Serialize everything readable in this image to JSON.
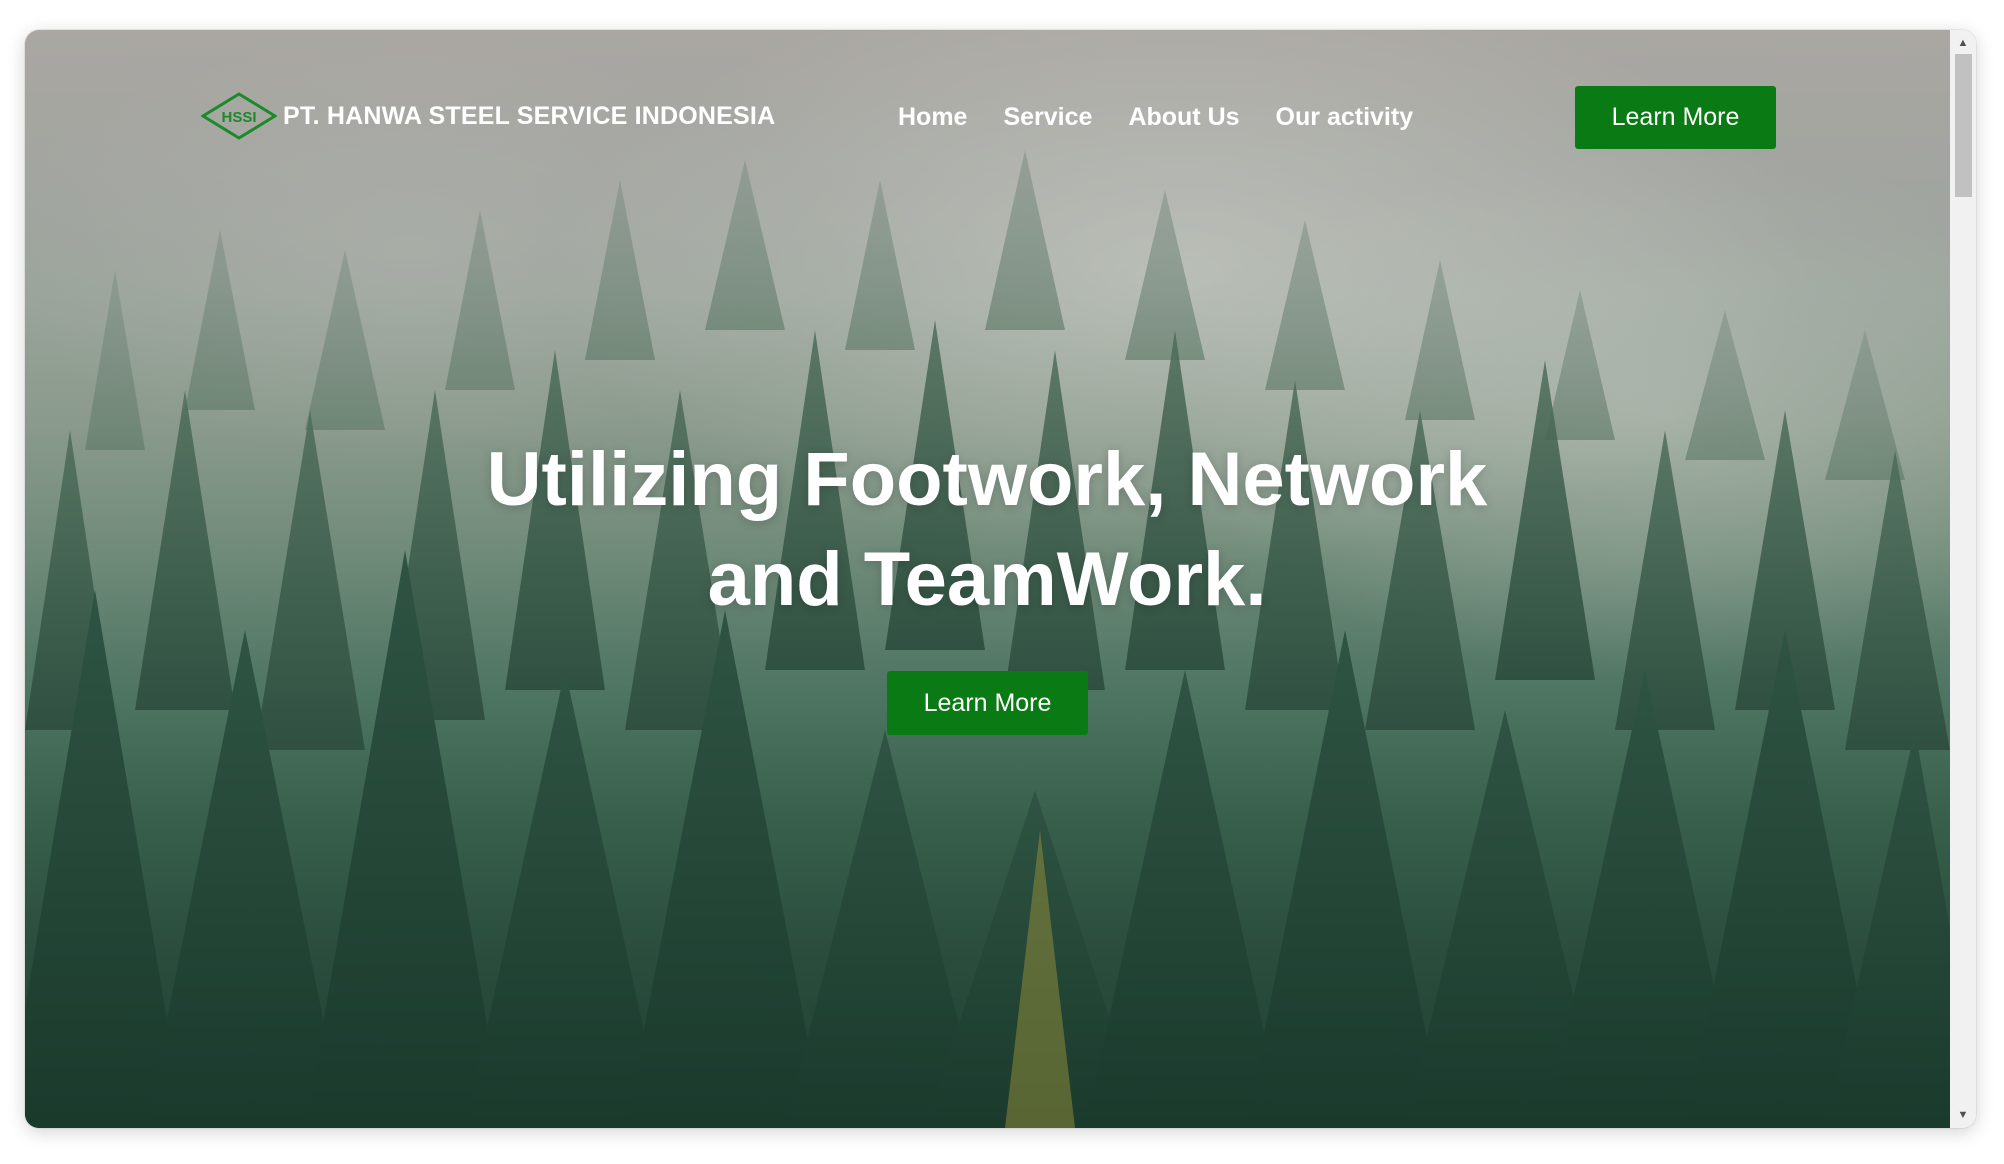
{
  "navbar": {
    "brand_name": "PT. HANWA STEEL SERVICE INDONESIA",
    "logo_text": "HSSI",
    "links": [
      {
        "label": "Home"
      },
      {
        "label": "Service"
      },
      {
        "label": "About Us"
      },
      {
        "label": "Our activity"
      }
    ],
    "cta_label": "Learn More"
  },
  "hero": {
    "headline_line1": "Utilizing Footwork, Network",
    "headline_line2": "and TeamWork.",
    "cta_label": "Learn More"
  },
  "colors": {
    "accent_green": "#0a7a14",
    "logo_green": "#1a8a2a",
    "text_white": "#ffffff"
  },
  "icons": {
    "scroll_up": "triangle-up-icon",
    "scroll_down": "triangle-down-icon",
    "logo": "hssi-diamond-logo"
  }
}
